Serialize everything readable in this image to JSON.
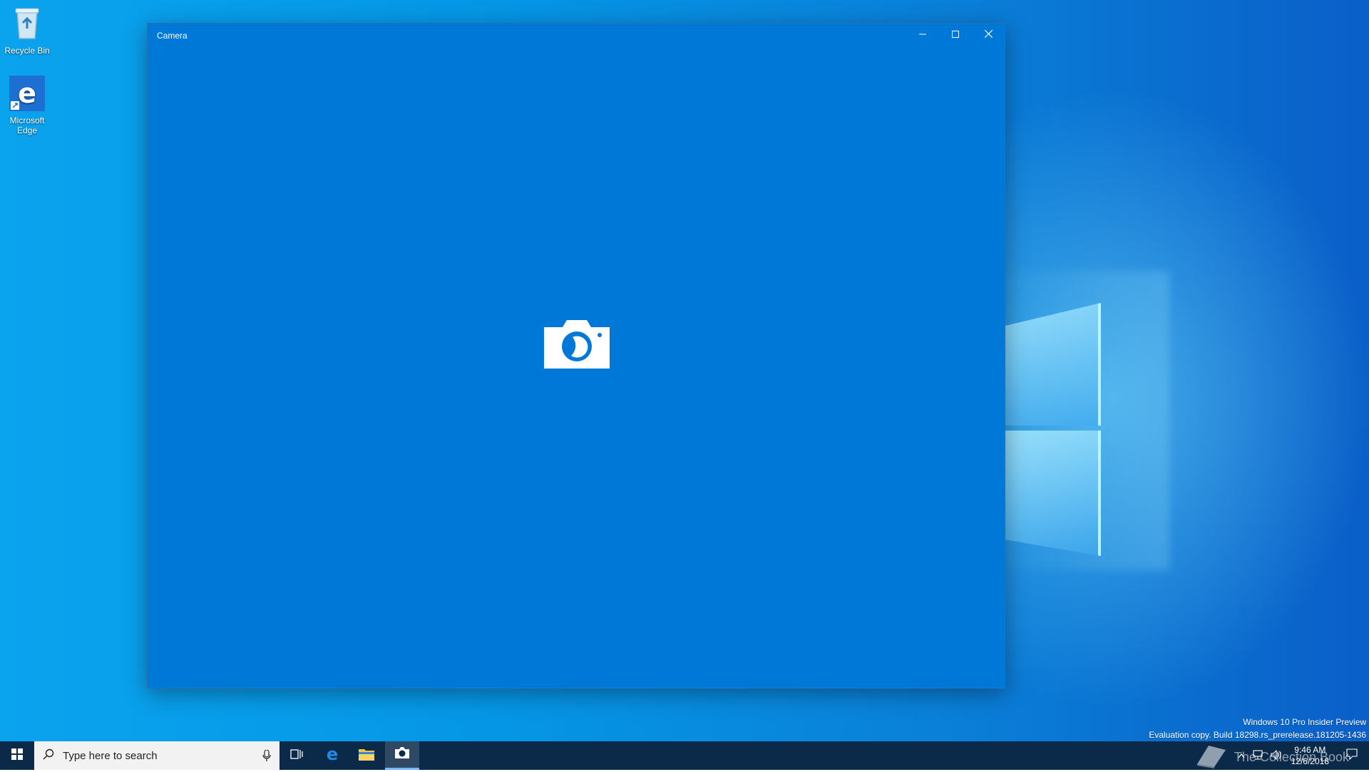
{
  "desktop": {
    "icons": [
      {
        "label": "Recycle Bin",
        "icon": "recycle-bin-icon"
      },
      {
        "label": "Microsoft Edge",
        "icon": "edge-icon"
      }
    ],
    "watermark": {
      "line1": "Windows 10 Pro Insider Preview",
      "line2": "Evaluation copy. Build 18298.rs_prerelease.181205-1436"
    }
  },
  "window": {
    "title": "Camera",
    "center_icon": "camera-icon",
    "background_color": "#0078d7",
    "controls": {
      "minimize": "minimize-icon",
      "maximize": "maximize-icon",
      "close": "close-icon"
    }
  },
  "taskbar": {
    "search": {
      "placeholder": "Type here to search"
    },
    "apps": [
      {
        "name": "task-view",
        "icon": "task-view-icon"
      },
      {
        "name": "edge",
        "icon": "edge-icon"
      },
      {
        "name": "file-explorer",
        "icon": "folder-icon"
      },
      {
        "name": "camera",
        "icon": "camera-icon",
        "active": true
      }
    ],
    "clock": {
      "time": "9:46 AM",
      "date": "12/6/2018"
    },
    "overlay_text": "The Collection Book"
  },
  "colors": {
    "taskbar": "#0b2a4a",
    "window": "#0078d7",
    "search_box": "#f2f2f2"
  }
}
